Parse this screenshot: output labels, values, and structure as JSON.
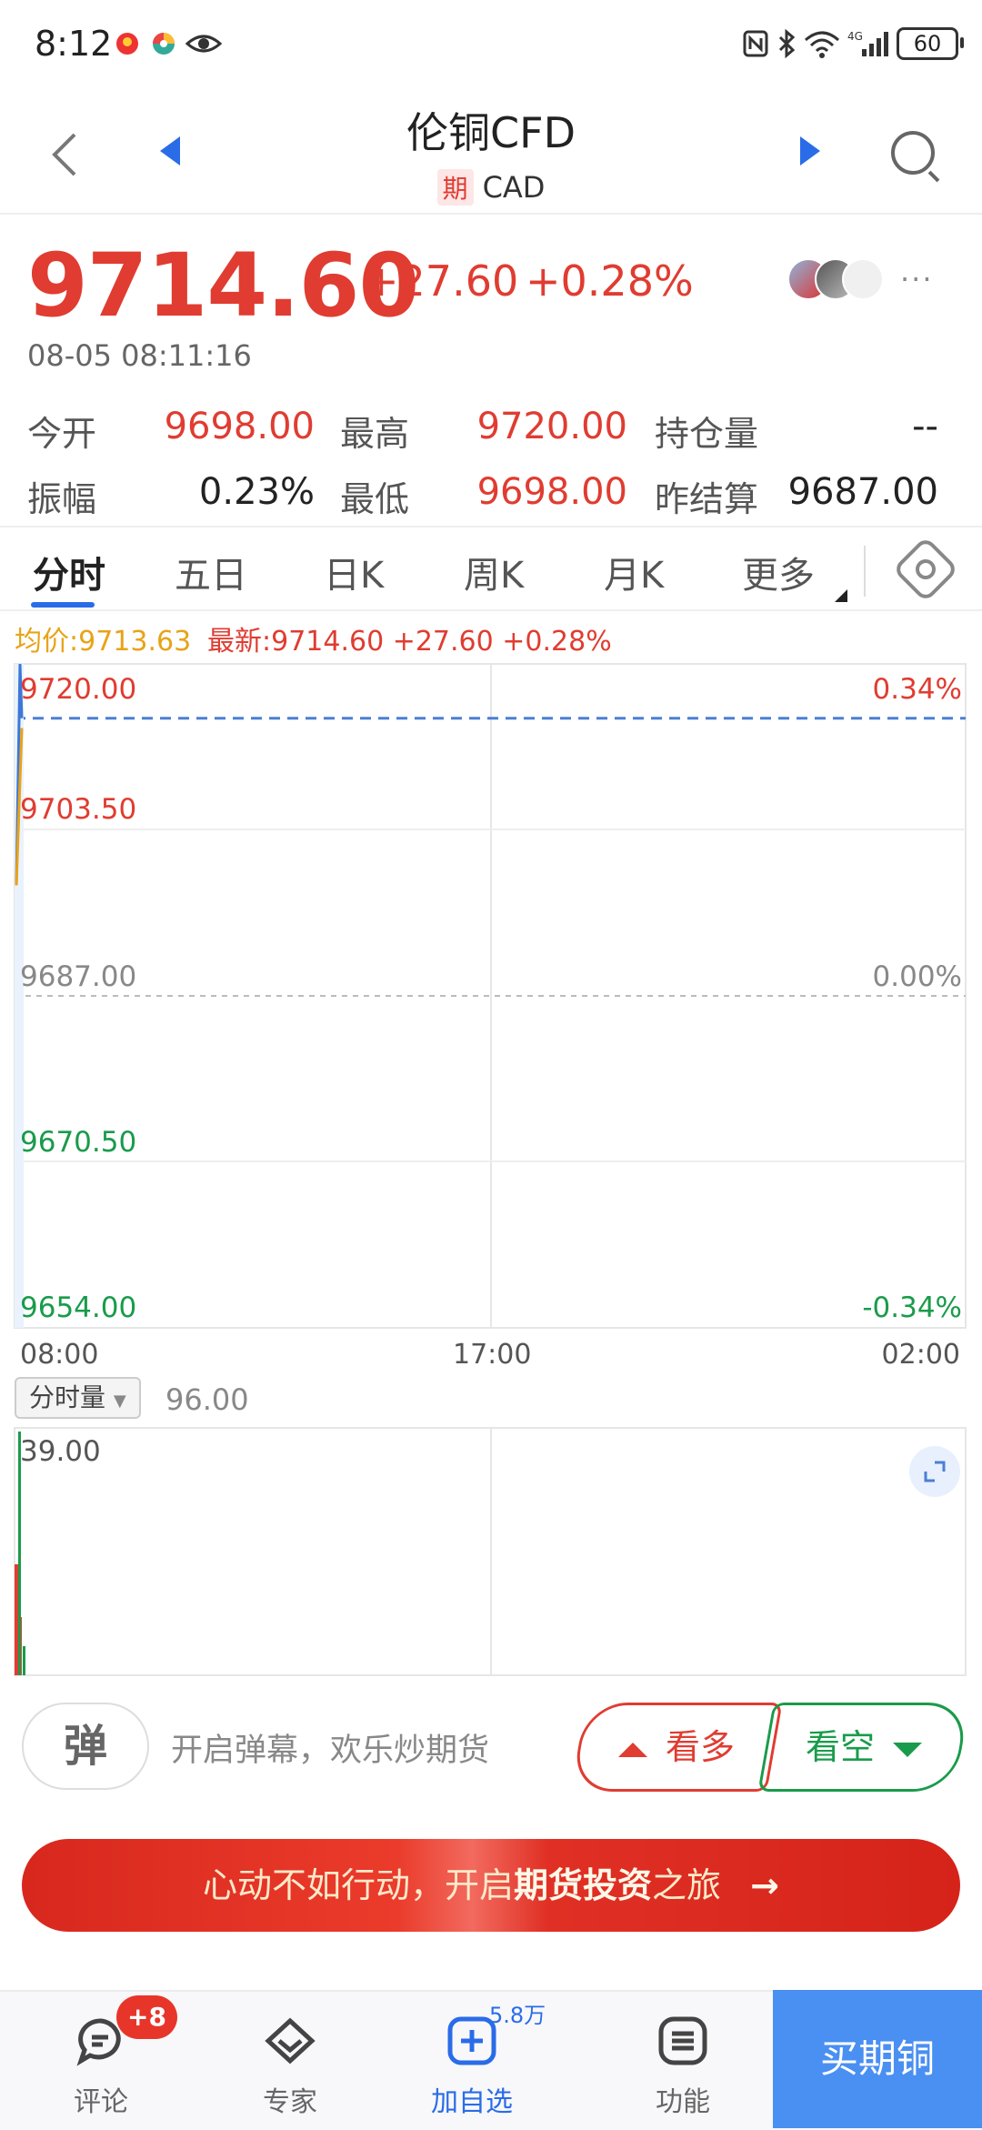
{
  "status_bar": {
    "time": "8:12",
    "battery": "60",
    "network": "4G"
  },
  "header": {
    "title": "伦铜CFD",
    "badge": "期",
    "code": "CAD"
  },
  "quote": {
    "price": "9714.60",
    "change": "+27.60",
    "change_pct": "+0.28%",
    "timestamp": "08-05 08:11:16"
  },
  "stats": [
    {
      "label": "今开",
      "value": "9698.00",
      "tone": "red"
    },
    {
      "label": "最高",
      "value": "9720.00",
      "tone": "red"
    },
    {
      "label": "持仓量",
      "value": "--",
      "tone": "dark"
    },
    {
      "label": "振幅",
      "value": "0.23%",
      "tone": "dark"
    },
    {
      "label": "最低",
      "value": "9698.00",
      "tone": "red"
    },
    {
      "label": "昨结算",
      "value": "9687.00",
      "tone": "dark"
    }
  ],
  "tabs": [
    "分时",
    "五日",
    "日K",
    "周K",
    "月K",
    "更多"
  ],
  "indicators": {
    "avg": "均价:9713.63",
    "latest": "最新:9714.60  +27.60  +0.28%"
  },
  "chart_data": {
    "type": "line",
    "y_ticks": [
      "9720.00",
      "9703.50",
      "9687.00",
      "9670.50",
      "9654.00"
    ],
    "pct_ticks": [
      "0.34%",
      "0.00%",
      "-0.34%"
    ],
    "x_ticks": [
      "08:00",
      "17:00",
      "02:00"
    ],
    "ylim": [
      9654.0,
      9720.0
    ],
    "prev_settle": 9687.0,
    "series": [
      {
        "values": [
          9698.0,
          9720.0,
          9714.6
        ]
      }
    ]
  },
  "volume": {
    "selector": "分时量",
    "value": "96.00",
    "max_label": "39.00"
  },
  "danmaku": {
    "toggle_label": "弹",
    "placeholder": "开启弹幕，欢乐炒期货"
  },
  "actions": {
    "bull": "看多",
    "bear": "看空"
  },
  "promo": {
    "prefix": "心动不如行动，开启",
    "strong": "期货投资",
    "suffix": "之旅"
  },
  "bottom_nav": {
    "items": [
      "评论",
      "专家",
      "加自选",
      "功能"
    ],
    "badge": "+8",
    "watch_count": "5.8万",
    "buy": "买期铜"
  },
  "colors": {
    "up": "#e03c31",
    "down": "#1a9b4b",
    "accent": "#2a6ce8",
    "avg": "#e8a317"
  }
}
